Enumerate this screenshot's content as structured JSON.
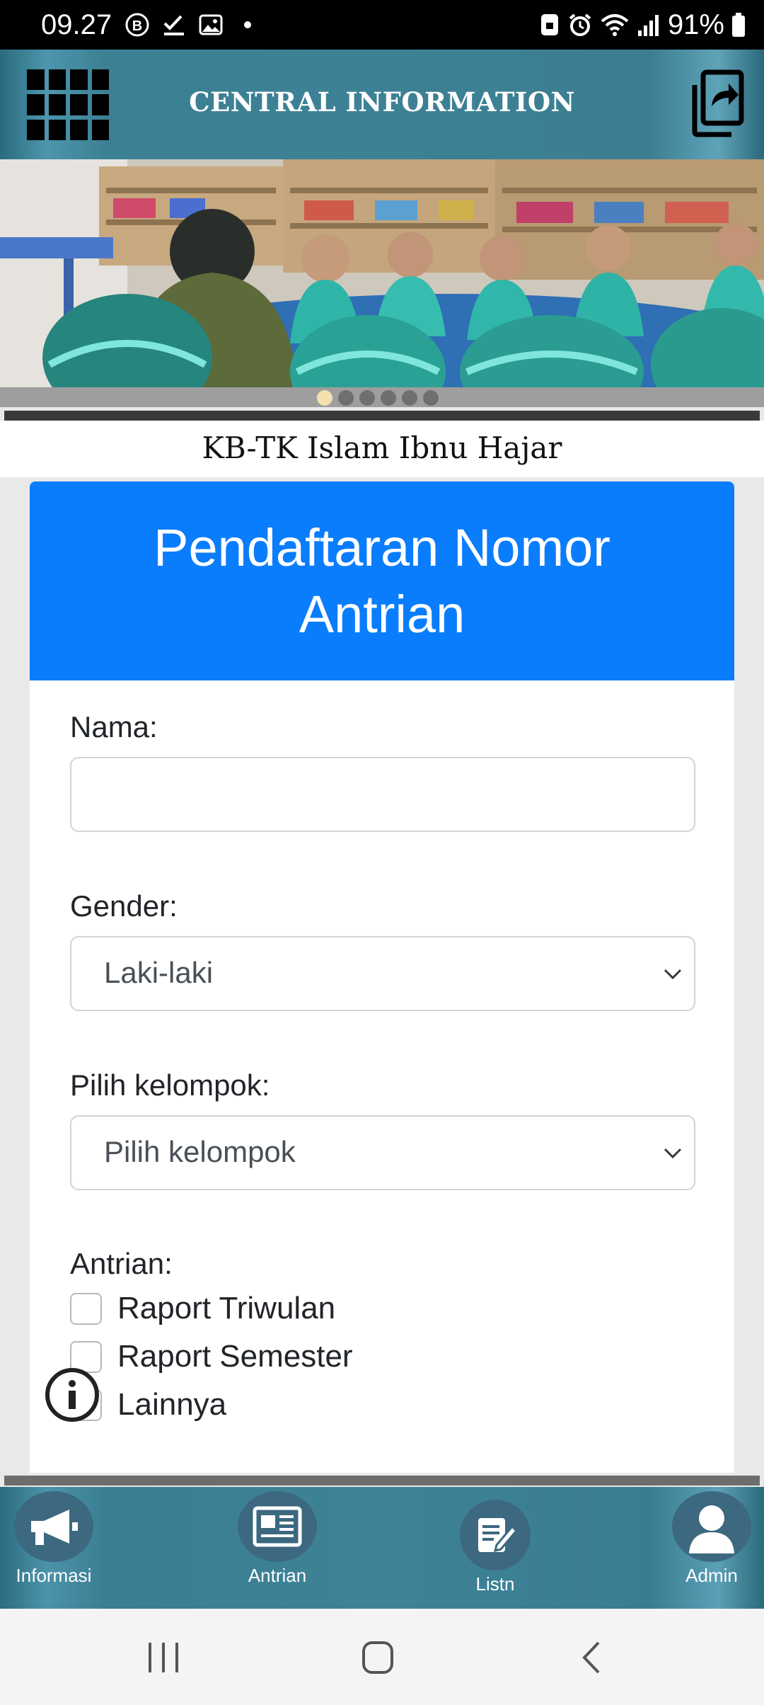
{
  "status_bar": {
    "time": "09.27",
    "battery": "91%"
  },
  "header": {
    "title": "CENTRAL INFORMATION"
  },
  "banner": {
    "slide_count": 6,
    "active_slide": 1
  },
  "school_name": "KB-TK Islam Ibnu Hajar",
  "form": {
    "title": "Pendaftaran Nomor Antrian",
    "nama_label": "Nama:",
    "nama_value": "",
    "gender_label": "Gender:",
    "gender_value": "Laki-laki",
    "kelompok_label": "Pilih kelompok:",
    "kelompok_value": "Pilih kelompok",
    "antrian_label": "Antrian:",
    "antrian_options": [
      "Raport Triwulan",
      "Raport Semester",
      "Lainnya"
    ]
  },
  "bottom_nav": {
    "items": [
      "Informasi",
      "Antrian",
      "Listn",
      "Admin"
    ]
  },
  "colors": {
    "header_teal": "#3d8195",
    "card_header_blue": "#0a7dfc",
    "status_bar": "#000000"
  }
}
